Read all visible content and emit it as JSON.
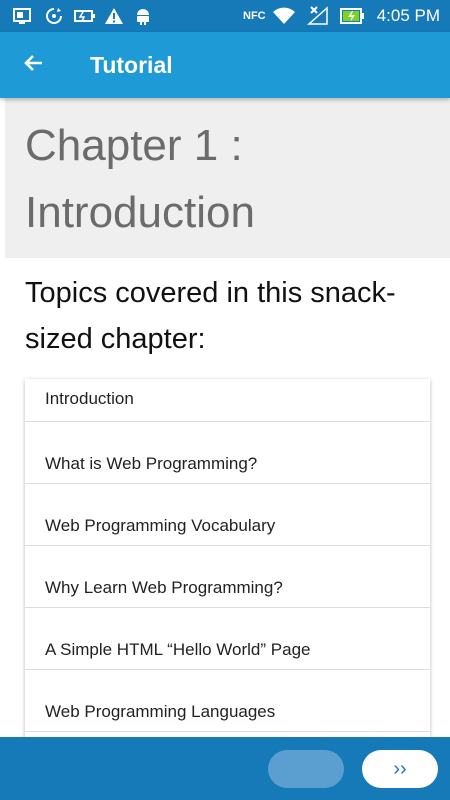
{
  "status_bar": {
    "time": "4:05 PM",
    "icons": [
      "screen-mirror-icon",
      "sync-icon",
      "battery-saver-icon",
      "warning-icon",
      "android-debug-icon",
      "nfc-icon",
      "wifi-icon",
      "no-signal-icon",
      "battery-charging-icon"
    ],
    "nfc_label": "NFC"
  },
  "app_bar": {
    "title": "Tutorial",
    "back_icon": "arrow-left-icon"
  },
  "chapter": {
    "title_line1": "Chapter 1 :",
    "title_line2": "Introduction"
  },
  "topics": {
    "heading": "Topics covered in this snack-sized chapter:",
    "items": [
      "Introduction",
      "What is Web Programming?",
      "Web Programming Vocabulary",
      "Why Learn Web Programming?",
      "A Simple HTML “Hello World” Page",
      "Web Programming Languages"
    ]
  },
  "bottom_nav": {
    "prev_label": "‹‹",
    "next_label": "››",
    "prev_enabled": false
  },
  "colors": {
    "status_bar": "#1679b8",
    "app_bar": "#1e9ad6",
    "header_bg": "#efefef"
  }
}
